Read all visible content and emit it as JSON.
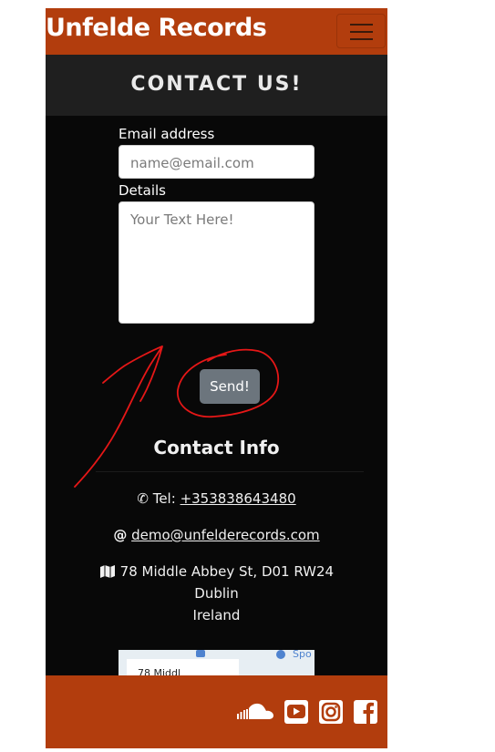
{
  "brand": {
    "name": "Unfelde Records"
  },
  "header": {
    "title": "CONTACT US!"
  },
  "form": {
    "email_label": "Email address",
    "email_placeholder": "name@email.com",
    "details_label": "Details",
    "details_placeholder": "Your Text Here!",
    "send_label": "Send!"
  },
  "contact": {
    "title": "Contact Info",
    "tel_label": "Tel:",
    "tel": "+353838643480",
    "email": "demo@unfelderecords.com",
    "address_line1": "78 Middle Abbey St, D01 RW24",
    "address_line2": "Dublin",
    "address_line3": "Ireland"
  },
  "map": {
    "card_text": "78 Middl",
    "poi_text": "Spo"
  },
  "footer": {
    "icons": [
      "soundcloud-icon",
      "youtube-icon",
      "instagram-icon",
      "facebook-icon"
    ]
  },
  "colors": {
    "brand": "#b23d0d",
    "background": "#080808",
    "header": "#1f1f1f",
    "button": "#6c757d",
    "annotation": "#e51717"
  }
}
